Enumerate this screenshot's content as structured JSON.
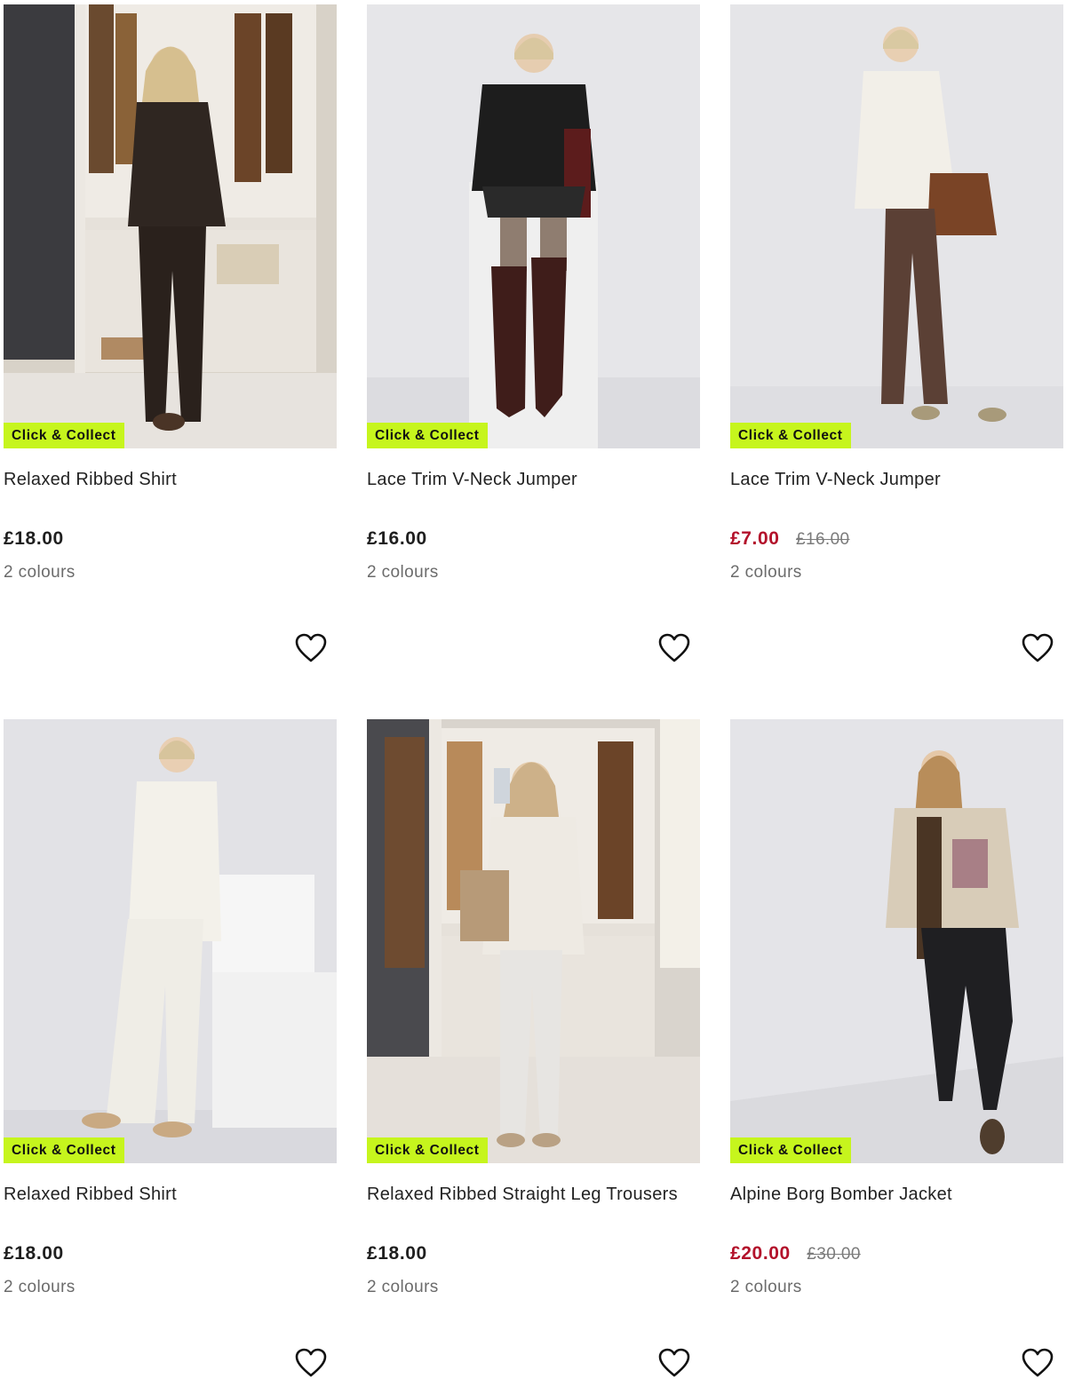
{
  "badge_label": "Click & Collect",
  "colors": {
    "badge_bg": "#c6f51d",
    "sale_price": "#b3122b",
    "was_price": "#7b7b7b"
  },
  "products": [
    {
      "name": "Relaxed Ribbed Shirt",
      "price": "£18.00",
      "was_price": "",
      "on_sale": false,
      "colours": "2 colours",
      "image_desc_icon": "model-photo"
    },
    {
      "name": "Lace Trim V-Neck Jumper",
      "price": "£16.00",
      "was_price": "",
      "on_sale": false,
      "colours": "2 colours",
      "image_desc_icon": "model-photo"
    },
    {
      "name": "Lace Trim V-Neck Jumper",
      "price": "£7.00",
      "was_price": "£16.00",
      "on_sale": true,
      "colours": "2 colours",
      "image_desc_icon": "model-photo"
    },
    {
      "name": "Relaxed Ribbed Shirt",
      "price": "£18.00",
      "was_price": "",
      "on_sale": false,
      "colours": "2 colours",
      "image_desc_icon": "model-photo"
    },
    {
      "name": "Relaxed Ribbed Straight Leg Trousers",
      "price": "£18.00",
      "was_price": "",
      "on_sale": false,
      "colours": "2 colours",
      "image_desc_icon": "model-photo"
    },
    {
      "name": "Alpine Borg Bomber Jacket",
      "price": "£20.00",
      "was_price": "£30.00",
      "on_sale": true,
      "colours": "2 colours",
      "image_desc_icon": "model-photo"
    }
  ]
}
